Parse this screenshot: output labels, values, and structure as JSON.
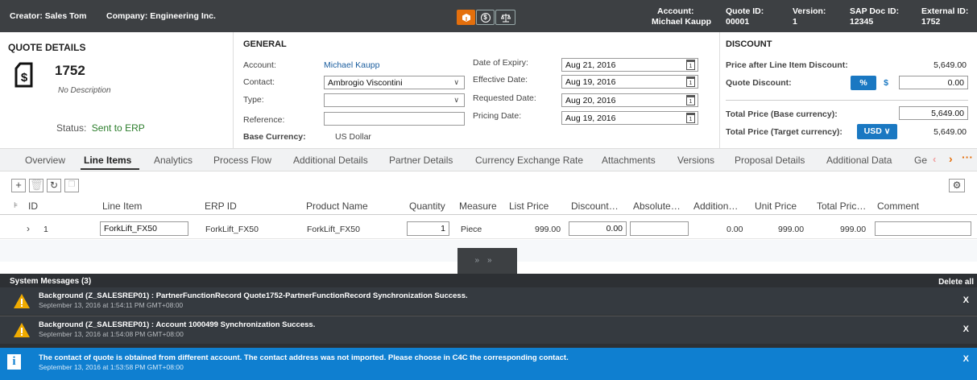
{
  "header": {
    "creator": "Creator: Sales Tom",
    "company": "Company: Engineering Inc.",
    "account_label": "Account:",
    "account_value": "Michael Kaupp",
    "quote_id_label": "Quote ID:",
    "quote_id_value": "00001",
    "version_label": "Version:",
    "version_value": "1",
    "sap_label": "SAP Doc ID:",
    "sap_value": "12345",
    "external_label": "External ID:",
    "external_value": "1752",
    "icon_buttons": [
      "box-icon",
      "dollar-icon",
      "scale-icon"
    ]
  },
  "quote_details": {
    "title": "QUOTE DETAILS",
    "number": "1752",
    "description": "No Description",
    "status_label": "Status:",
    "status_value": "Sent to ERP"
  },
  "general": {
    "title": "GENERAL",
    "account_label": "Account:",
    "account_value": "Michael Kaupp",
    "contact_label": "Contact:",
    "contact_value": "Ambrogio Viscontini",
    "type_label": "Type:",
    "type_value": "",
    "reference_label": "Reference:",
    "reference_value": "",
    "currency_label": "Base Currency:",
    "currency_value": "US Dollar",
    "expiry_label": "Date of Expiry:",
    "expiry_value": "Aug 21, 2016",
    "effective_label": "Effective Date:",
    "effective_value": "Aug 19, 2016",
    "requested_label": "Requested Date:",
    "requested_value": "Aug 20, 2016",
    "pricing_label": "Pricing Date:",
    "pricing_value": "Aug 19, 2016"
  },
  "discount": {
    "title": "DISCOUNT",
    "after_label": "Price after Line Item Discount:",
    "after_value": "5,649.00",
    "quote_label": "Quote Discount:",
    "pct_btn": "%",
    "dollar_btn": "$",
    "quote_value": "0.00",
    "total_base_label": "Total Price (Base currency):",
    "total_base_value": "5,649.00",
    "total_target_label": "Total Price (Target currency):",
    "currency_btn": "USD ∨",
    "total_target_value": "5,649.00"
  },
  "tabs": [
    "Overview",
    "Line Items",
    "Analytics",
    "Process Flow",
    "Additional Details",
    "Partner Details",
    "Currency Exchange Rate",
    "Attachments",
    "Versions",
    "Proposal Details",
    "Additional Data",
    "Ge"
  ],
  "table": {
    "headers": {
      "id": "ID",
      "line_item": "Line Item",
      "erp_id": "ERP ID",
      "product": "Product Name",
      "quantity": "Quantity",
      "measure": "Measure",
      "list_price": "List Price",
      "discount": "Discount…",
      "absolute": "Absolute…",
      "addition": "Addition…",
      "unit_price": "Unit Price",
      "total_price": "Total Pric…",
      "comment": "Comment"
    },
    "row": {
      "id": "1",
      "line_item": "ForkLift_FX50",
      "erp_id": "ForkLift_FX50",
      "product": "ForkLift_FX50",
      "quantity": "1",
      "measure": "Piece",
      "list_price": "999.00",
      "discount": "0.00",
      "absolute": "",
      "addition": "0.00",
      "unit_price": "999.00",
      "total_price": "999.00",
      "comment": ""
    }
  },
  "messages": {
    "title": "System Messages (3)",
    "delete_all": "Delete all",
    "close": "X",
    "items": [
      {
        "type": "warning",
        "text": "Background (Z_SALESREP01) : PartnerFunctionRecord Quote1752-PartnerFunctionRecord Synchronization Success.",
        "date": "September 13, 2016 at 1:54:11 PM GMT+08:00"
      },
      {
        "type": "warning",
        "text": "Background (Z_SALESREP01) : Account 1000499 Synchronization Success.",
        "date": "September 13, 2016 at 1:54:08 PM GMT+08:00"
      },
      {
        "type": "info",
        "text": "The contact of quote is obtained from different account. The contact address was not imported. Please choose in C4C the corresponding contact.",
        "date": "September 13, 2016 at 1:53:58 PM GMT+08:00"
      }
    ]
  },
  "colors": {
    "header_bg": "#3d4043",
    "accent": "#1a78c2",
    "orange": "#e46f0c",
    "status_green": "#2b7d2b",
    "info_blue": "#0f7fd0"
  }
}
